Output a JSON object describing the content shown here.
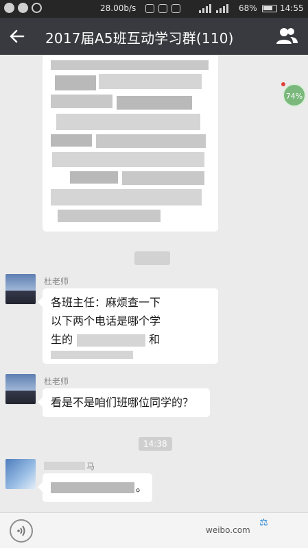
{
  "status_bar": {
    "net_speed": "28.00b/s",
    "battery": "68%",
    "time": "14:55"
  },
  "header": {
    "back_icon": "arrow-left-icon",
    "title": "2017届A5班互动学习群(110)",
    "members_icon": "group-people-icon"
  },
  "floating_badge": {
    "label": "74%"
  },
  "messages": [
    {
      "sender": "杜老师",
      "line1": "各班主任：麻烦查一下",
      "line2": "以下两个电话是哪个学",
      "line3_prefix": "生的",
      "line3_suffix": "和"
    },
    {
      "sender": "杜老师",
      "text": "看是不是咱们班哪位同学的？"
    }
  ],
  "timestamp": "14:38",
  "last_message": {
    "sender_suffix": "马",
    "text_suffix": "。"
  },
  "bottom": {
    "voice_icon": "voice-icon",
    "watermark": "weibo.com"
  },
  "colors": {
    "title_bar": "#393a3f",
    "status_bar": "#262626",
    "chat_background": "#ebebeb",
    "bubble": "#ffffff"
  }
}
